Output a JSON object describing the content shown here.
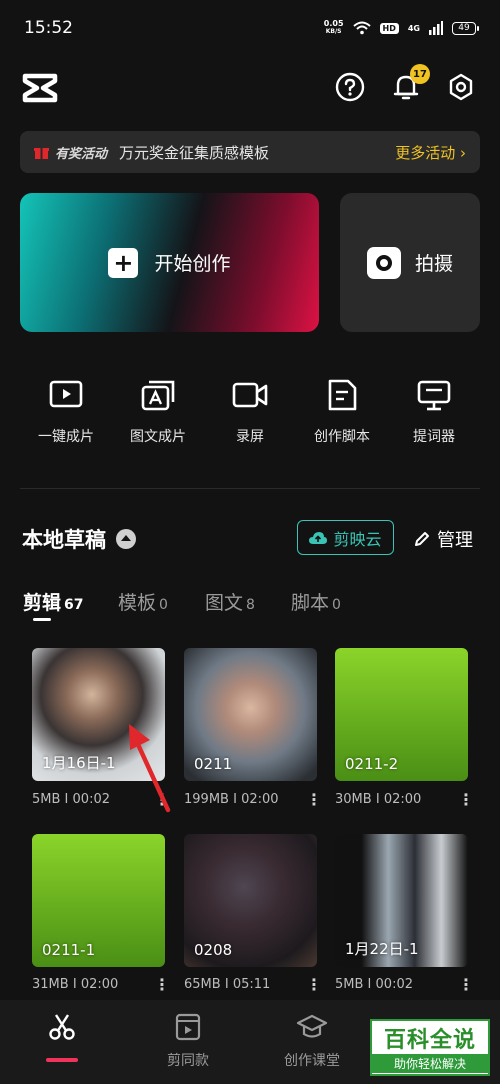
{
  "status": {
    "time": "15:52",
    "speed_value": "0.05",
    "speed_unit": "KB/S",
    "hd": "HD",
    "net": "4G",
    "battery": "49"
  },
  "header": {
    "notification_count": "17"
  },
  "banner": {
    "tag": "有奖活动",
    "text": "万元奖金征集质感模板",
    "more": "更多活动 ›"
  },
  "create": {
    "start_label": "开始创作",
    "shoot_label": "拍摄"
  },
  "tools": [
    {
      "label": "一键成片",
      "icon": "play-icon"
    },
    {
      "label": "图文成片",
      "icon": "text-image-icon"
    },
    {
      "label": "录屏",
      "icon": "record-icon"
    },
    {
      "label": "创作脚本",
      "icon": "script-icon"
    },
    {
      "label": "提词器",
      "icon": "prompter-icon"
    }
  ],
  "drafts": {
    "title": "本地草稿",
    "cloud_label": "剪映云",
    "manage_label": "管理",
    "tabs": [
      {
        "label": "剪辑",
        "count": "67",
        "active": true
      },
      {
        "label": "模板",
        "count": "0"
      },
      {
        "label": "图文",
        "count": "8"
      },
      {
        "label": "脚本",
        "count": "0"
      }
    ],
    "items": [
      {
        "name": "1月16日-1",
        "size": "5MB",
        "duration": "00:02"
      },
      {
        "name": "0211",
        "size": "199MB",
        "duration": "02:00"
      },
      {
        "name": "0211-2",
        "size": "30MB",
        "duration": "02:00"
      },
      {
        "name": "0211-1",
        "size": "31MB",
        "duration": "02:00"
      },
      {
        "name": "0208",
        "size": "65MB",
        "duration": "05:11"
      },
      {
        "name": "1月22日-1",
        "size": "5MB",
        "duration": "00:02"
      }
    ],
    "meta_sep": "I",
    "more": "⋮"
  },
  "nav": {
    "items": [
      {
        "label": ""
      },
      {
        "label": "剪同款"
      },
      {
        "label": "创作课堂"
      }
    ]
  },
  "watermark": {
    "title": "百科全说",
    "subtitle": "助你轻松解决"
  },
  "colors": {
    "accent": "#39c4b6",
    "highlight": "#f0c323",
    "nav_indicator": "#f0335a",
    "arrow": "#e0272b"
  }
}
